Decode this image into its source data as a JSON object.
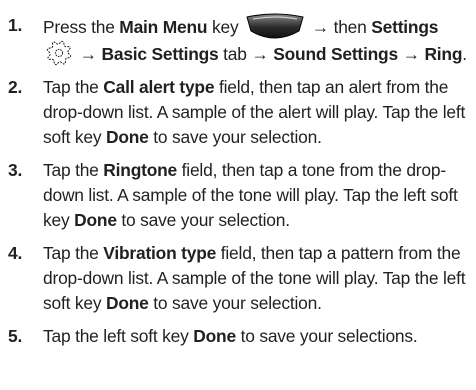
{
  "steps": [
    {
      "num": "1.",
      "parts": [
        {
          "t": "Press the "
        },
        {
          "b": "Main Menu"
        },
        {
          "t": " key "
        },
        {
          "icon": "menu-key-icon"
        },
        {
          "t": " "
        },
        {
          "arrow": "→"
        },
        {
          "t": " then "
        },
        {
          "b": "Settings"
        },
        {
          "t": " "
        },
        {
          "icon": "settings-gear-icon"
        },
        {
          "t": " "
        },
        {
          "arrow": "→"
        },
        {
          "t": " "
        },
        {
          "b": "Basic Settings"
        },
        {
          "t": " tab "
        },
        {
          "arrow": "→"
        },
        {
          "t": " "
        },
        {
          "b": "Sound Settings"
        },
        {
          "t": " "
        },
        {
          "arrow": "→"
        },
        {
          "t": " "
        },
        {
          "b": "Ring"
        },
        {
          "t": "."
        }
      ]
    },
    {
      "num": "2.",
      "parts": [
        {
          "t": "Tap the "
        },
        {
          "b": "Call alert type"
        },
        {
          "t": " field, then tap an alert from the drop-down list. A sample of the alert will play. Tap the left soft key "
        },
        {
          "b": "Done"
        },
        {
          "t": " to save your selection."
        }
      ]
    },
    {
      "num": "3.",
      "parts": [
        {
          "t": "Tap the "
        },
        {
          "b": "Ringtone"
        },
        {
          "t": " field, then tap a tone from the drop-down list. A sample of the tone will play. Tap the left soft key "
        },
        {
          "b": "Done"
        },
        {
          "t": " to save your selection."
        }
      ]
    },
    {
      "num": "4.",
      "parts": [
        {
          "t": "Tap the "
        },
        {
          "b": "Vibration type"
        },
        {
          "t": " field, then tap a pattern from the drop-down list. A sample of the tone will play. Tap the left soft key "
        },
        {
          "b": "Done"
        },
        {
          "t": " to save your selection."
        }
      ]
    },
    {
      "num": "5.",
      "parts": [
        {
          "t": "Tap the left soft key "
        },
        {
          "b": "Done"
        },
        {
          "t": " to save your selections."
        }
      ]
    }
  ],
  "colors": {
    "text": "#231f20",
    "background": "#ffffff",
    "menu_key_dark": "#2b2b2b",
    "menu_key_light": "#8a8a8a"
  }
}
